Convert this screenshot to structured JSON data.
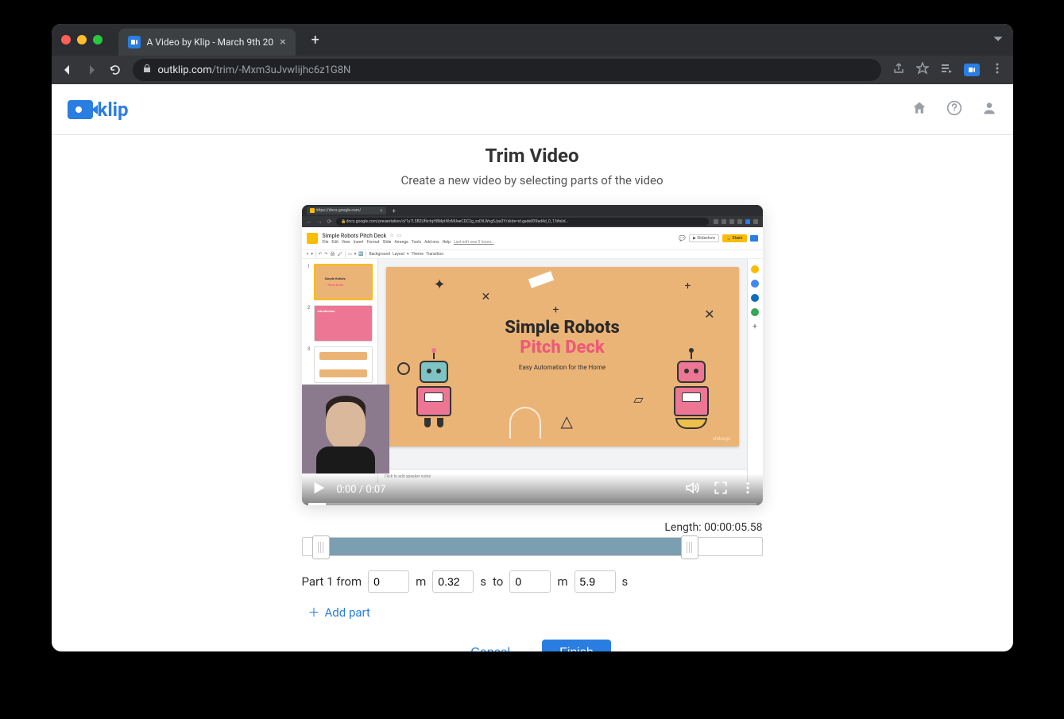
{
  "browser": {
    "tab_title": "A Video by Klip - March 9th 20",
    "url_host": "outklip.com",
    "url_path": "/trim/-Mxm3uJvwIijhc6z1G8N"
  },
  "app": {
    "logo_text": "klip"
  },
  "page": {
    "title": "Trim Video",
    "subtitle": "Create a new video by selecting parts of the video"
  },
  "video": {
    "inner_tab": "https://docs.google.com/",
    "inner_url": "docs.google.com/presentation/d/1y7L5B2UfbctqH8MptWzMUeeCDC2g_xsDtLWvg5Jya3Y/slide=id.gade839ad4d_0_13#slid…",
    "doc_title": "Simple Robots Pitch Deck",
    "doc_menu": [
      "File",
      "Edit",
      "View",
      "Insert",
      "Format",
      "Slide",
      "Arrange",
      "Tools",
      "Add-ons",
      "Help"
    ],
    "doc_last_edit": "Last edit was 5 hours…",
    "doc_toolbar": [
      "Background",
      "Layout",
      "Theme",
      "Transition"
    ],
    "slideshow_label": "Slideshow",
    "share_label": "Share",
    "slide": {
      "line1": "Simple Robots",
      "line2": "Pitch Deck",
      "line3": "Easy Automation for the Home",
      "watermark": "slidesgo"
    },
    "thumbs": {
      "t1a": "Simple Robots",
      "t1b": "Pitch Deck",
      "t2": "Introduction"
    },
    "speaker_notes_placeholder": "Click to add speaker notes",
    "time_current": "0:00",
    "time_sep": " / ",
    "time_total": "0:07"
  },
  "trim": {
    "length_label": "Length: ",
    "length_value": "00:00:05.58",
    "part_label": "Part 1 from",
    "m_unit": "m",
    "s_unit": "s",
    "to_label": "to",
    "from_m": "0",
    "from_s": "0.32",
    "to_m": "0",
    "to_s": "5.9",
    "add_part": "Add part",
    "cancel": "Cancel",
    "finish": "Finish"
  }
}
